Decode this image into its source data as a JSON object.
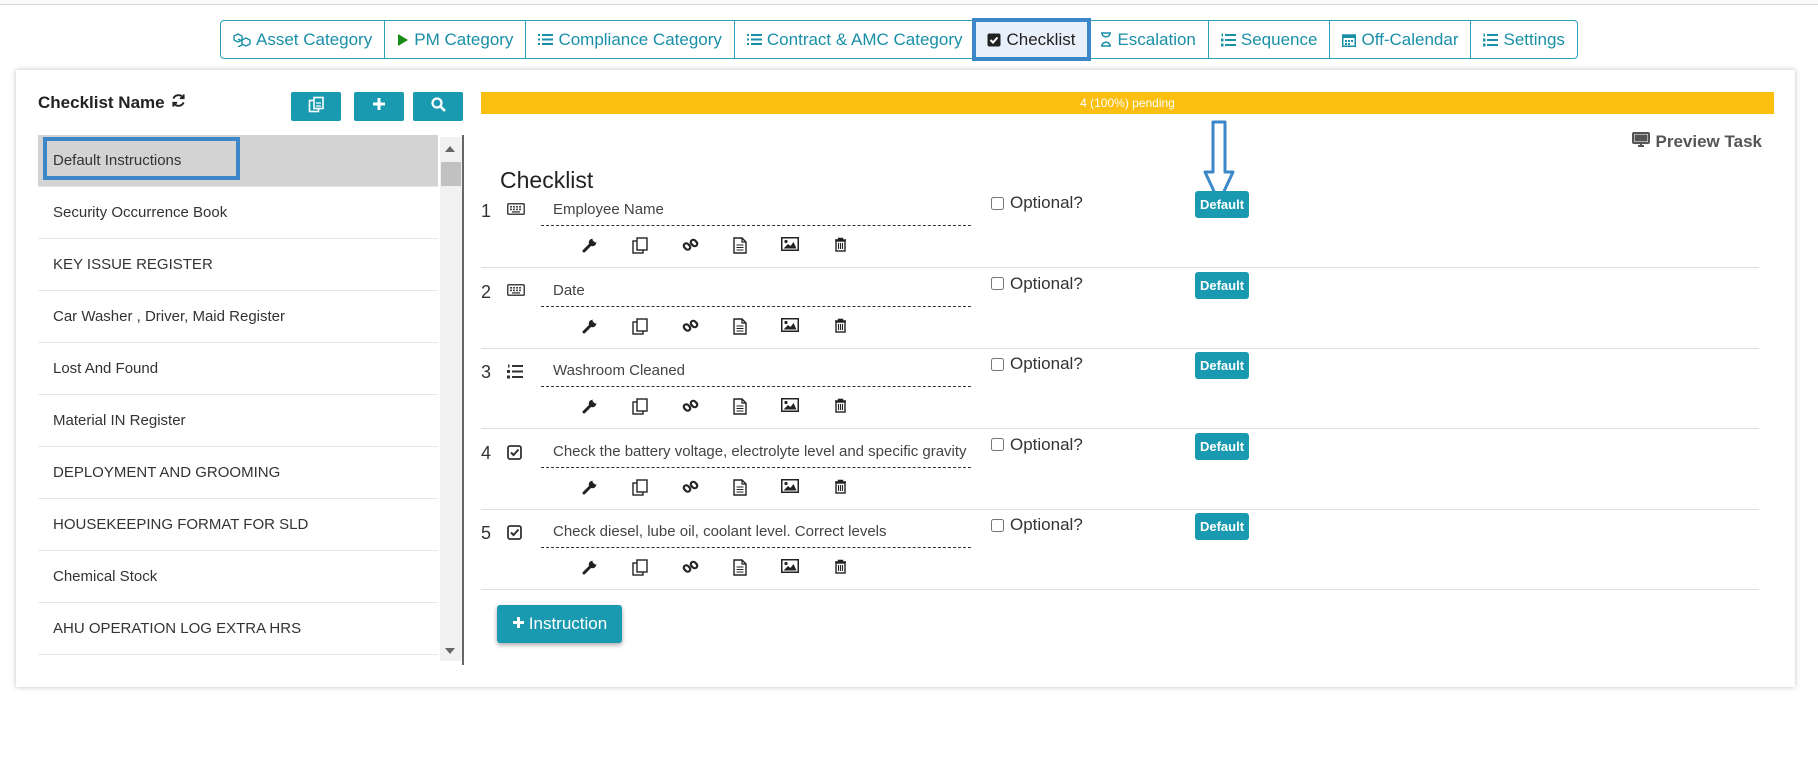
{
  "tabs": [
    {
      "label": "Asset Category",
      "icon": "cubes-icon"
    },
    {
      "label": "PM Category",
      "icon": "play-icon"
    },
    {
      "label": "Compliance Category",
      "icon": "list-icon"
    },
    {
      "label": "Contract & AMC Category",
      "icon": "list-icon"
    },
    {
      "label": "Checklist",
      "icon": "check-square-icon",
      "active": true
    },
    {
      "label": "Escalation",
      "icon": "hourglass-icon"
    },
    {
      "label": "Sequence",
      "icon": "ordered-list-icon"
    },
    {
      "label": "Off-Calendar",
      "icon": "calendar-icon"
    },
    {
      "label": "Settings",
      "icon": "ordered-list-icon"
    }
  ],
  "left_panel": {
    "title": "Checklist Name",
    "items": [
      "Default Instructions",
      "Security Occurrence Book",
      "KEY ISSUE REGISTER",
      "Car Washer , Driver, Maid Register",
      "Lost And Found",
      "Material IN Register",
      "DEPLOYMENT AND GROOMING",
      "HOUSEKEEPING FORMAT FOR SLD",
      "Chemical Stock",
      "AHU OPERATION LOG EXTRA HRS"
    ]
  },
  "progress": {
    "label": "4 (100%) pending",
    "fraction": 1.0,
    "color": "#fbbf0f"
  },
  "preview_label": "Preview Task",
  "checklist_title": "Checklist",
  "rows": [
    {
      "num": "1",
      "type_icon": "keyboard-icon",
      "value": "Employee Name",
      "optional": "Optional?",
      "badge": "Default"
    },
    {
      "num": "2",
      "type_icon": "keyboard-icon",
      "value": "Date",
      "optional": "Optional?",
      "badge": "Default"
    },
    {
      "num": "3",
      "type_icon": "ordered-list-icon",
      "value": "Washroom Cleaned",
      "optional": "Optional?",
      "badge": "Default"
    },
    {
      "num": "4",
      "type_icon": "check-square-icon",
      "value": "Check the battery voltage, electrolyte level and specific gravity",
      "optional": "Optional?",
      "badge": "Default"
    },
    {
      "num": "5",
      "type_icon": "check-square-icon",
      "value": "Check diesel, lube oil, coolant level. Correct levels",
      "optional": "Optional?",
      "badge": "Default"
    }
  ],
  "add_instruction_label": "Instruction",
  "colors": {
    "accent": "#1a9ab0",
    "highlight": "#3b87c8",
    "progress": "#fbbf0f"
  }
}
